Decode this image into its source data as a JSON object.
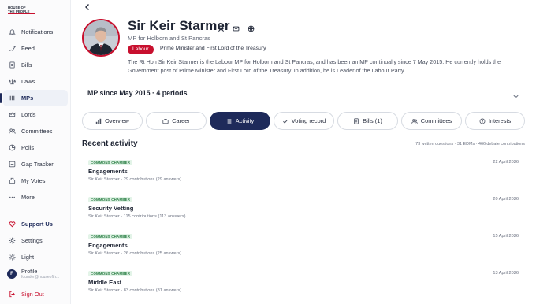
{
  "logo": {
    "line1": "HOUSE OF",
    "line2": "THE PEOPLE"
  },
  "nav": [
    {
      "label": "Notifications",
      "icon": "bell-icon"
    },
    {
      "label": "Feed",
      "icon": "feed-icon"
    },
    {
      "label": "Bills",
      "icon": "document-icon"
    },
    {
      "label": "Laws",
      "icon": "scales-icon"
    },
    {
      "label": "MPs",
      "icon": "people-icon"
    },
    {
      "label": "Lords",
      "icon": "crown-icon"
    },
    {
      "label": "Committees",
      "icon": "users-icon"
    },
    {
      "label": "Polls",
      "icon": "poll-icon"
    },
    {
      "label": "Gap Tracker",
      "icon": "gap-icon"
    },
    {
      "label": "My Votes",
      "icon": "vote-icon"
    },
    {
      "label": "More",
      "icon": "more-icon"
    }
  ],
  "bottom": {
    "support": "Support Us",
    "settings": "Settings",
    "theme": "Light",
    "profile_name": "Profile",
    "profile_email": "founder@houseofth...",
    "avatar_initial": "F",
    "signout": "Sign Out"
  },
  "mp": {
    "name": "Sir Keir Starmer",
    "constituency": "MP for Holborn and St Pancras",
    "party": "Labour",
    "role": "Prime Minister and First Lord of the Treasury",
    "bio": "The Rt Hon Sir Keir Starmer is the Labour MP for Holborn and St Pancras, and has been an MP continually since 7 May 2015. He currently holds the Government post of Prime Minister and First Lord of the Treasury. In addition, he is Leader of the Labour Party.",
    "periods": "MP since May 2015 · 4 periods"
  },
  "tabs": [
    {
      "label": "Overview",
      "icon": "chart-icon"
    },
    {
      "label": "Career",
      "icon": "briefcase-icon"
    },
    {
      "label": "Activity",
      "icon": "list-icon"
    },
    {
      "label": "Voting record",
      "icon": "check-icon"
    },
    {
      "label": "Bills (1)",
      "icon": "document-icon"
    },
    {
      "label": "Committees",
      "icon": "users-icon"
    },
    {
      "label": "Interests",
      "icon": "coin-icon"
    }
  ],
  "recent": {
    "title": "Recent activity",
    "stats": "73 written questions · 31 EDMs · 466 debate contributions",
    "items": [
      {
        "badge": "COMMONS CHAMBER",
        "title": "Engagements",
        "meta": "Sir Keir Starmer · 29 contributions (29 answers)",
        "date": "22 April 2026"
      },
      {
        "badge": "COMMONS CHAMBER",
        "title": "Security Vetting",
        "meta": "Sir Keir Starmer · 115 contributions (113 answers)",
        "date": "20 April 2026"
      },
      {
        "badge": "COMMONS CHAMBER",
        "title": "Engagements",
        "meta": "Sir Keir Starmer · 26 contributions (25 answers)",
        "date": "15 April 2026"
      },
      {
        "badge": "COMMONS CHAMBER",
        "title": "Middle East",
        "meta": "Sir Keir Starmer · 83 contributions (81 answers)",
        "date": "13 April 2026"
      }
    ]
  },
  "colors": {
    "accent": "#1e2a5a",
    "labour": "#c8102e",
    "badge_bg": "#e3f4e8",
    "badge_text": "#237a3e"
  }
}
